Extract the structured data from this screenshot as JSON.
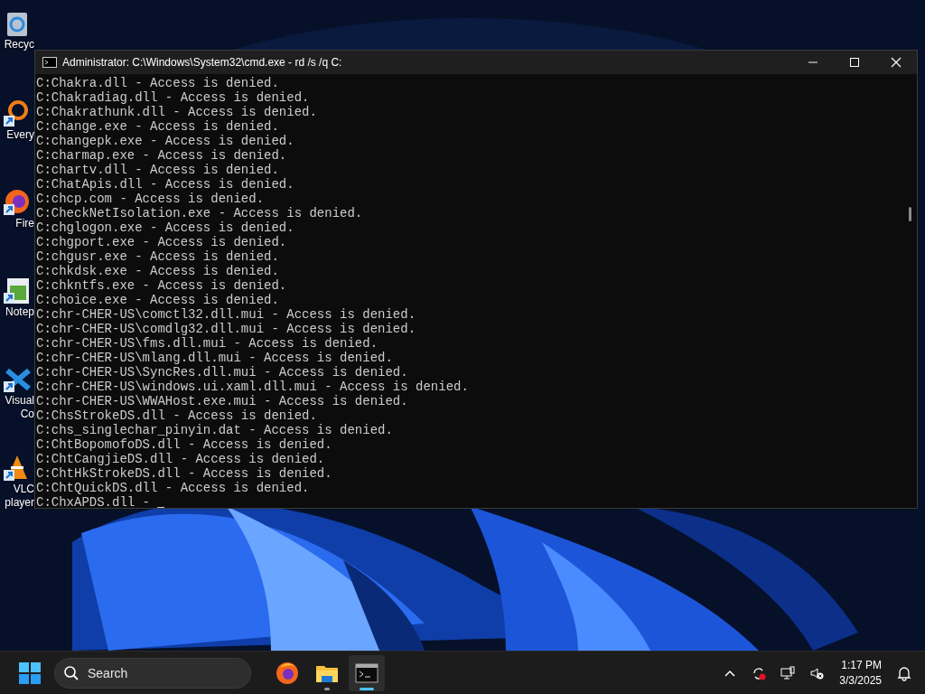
{
  "desktop_icons": [
    {
      "kind": "recycle",
      "label": [
        "Recyc"
      ]
    },
    {
      "kind": "search",
      "label": [
        "Every"
      ]
    },
    {
      "kind": "browser",
      "label": [
        "Fire"
      ]
    },
    {
      "kind": "notepad",
      "label": [
        "Notep"
      ]
    },
    {
      "kind": "code",
      "label": [
        "Visual",
        "Co"
      ]
    },
    {
      "kind": "cone",
      "label": [
        "VLC",
        "player"
      ]
    }
  ],
  "window": {
    "title": "Administrator: C:\\Windows\\System32\\cmd.exe - rd  /s /q C:",
    "lines": [
      "C:Chakra.dll - Access is denied.",
      "C:Chakradiag.dll - Access is denied.",
      "C:Chakrathunk.dll - Access is denied.",
      "C:change.exe - Access is denied.",
      "C:changepk.exe - Access is denied.",
      "C:charmap.exe - Access is denied.",
      "C:chartv.dll - Access is denied.",
      "C:ChatApis.dll - Access is denied.",
      "C:chcp.com - Access is denied.",
      "C:CheckNetIsolation.exe - Access is denied.",
      "C:chglogon.exe - Access is denied.",
      "C:chgport.exe - Access is denied.",
      "C:chgusr.exe - Access is denied.",
      "C:chkdsk.exe - Access is denied.",
      "C:chkntfs.exe - Access is denied.",
      "C:choice.exe - Access is denied.",
      "C:chr-CHER-US\\comctl32.dll.mui - Access is denied.",
      "C:chr-CHER-US\\comdlg32.dll.mui - Access is denied.",
      "C:chr-CHER-US\\fms.dll.mui - Access is denied.",
      "C:chr-CHER-US\\mlang.dll.mui - Access is denied.",
      "C:chr-CHER-US\\SyncRes.dll.mui - Access is denied.",
      "C:chr-CHER-US\\windows.ui.xaml.dll.mui - Access is denied.",
      "C:chr-CHER-US\\WWAHost.exe.mui - Access is denied.",
      "C:ChsStrokeDS.dll - Access is denied.",
      "C:chs_singlechar_pinyin.dat - Access is denied.",
      "C:ChtBopomofoDS.dll - Access is denied.",
      "C:ChtCangjieDS.dll - Access is denied.",
      "C:ChtHkStrokeDS.dll - Access is denied.",
      "C:ChtQuickDS.dll - Access is denied.",
      "C:ChxAPDS.dll - "
    ]
  },
  "taskbar": {
    "search": {
      "placeholder": "Search"
    },
    "apps": [
      {
        "kind": "browser",
        "running": false,
        "selected": false
      },
      {
        "kind": "folder",
        "running": true,
        "selected": false
      },
      {
        "kind": "terminal",
        "running": true,
        "selected": true
      }
    ],
    "time": "1:17 PM",
    "date": "3/3/2025"
  }
}
